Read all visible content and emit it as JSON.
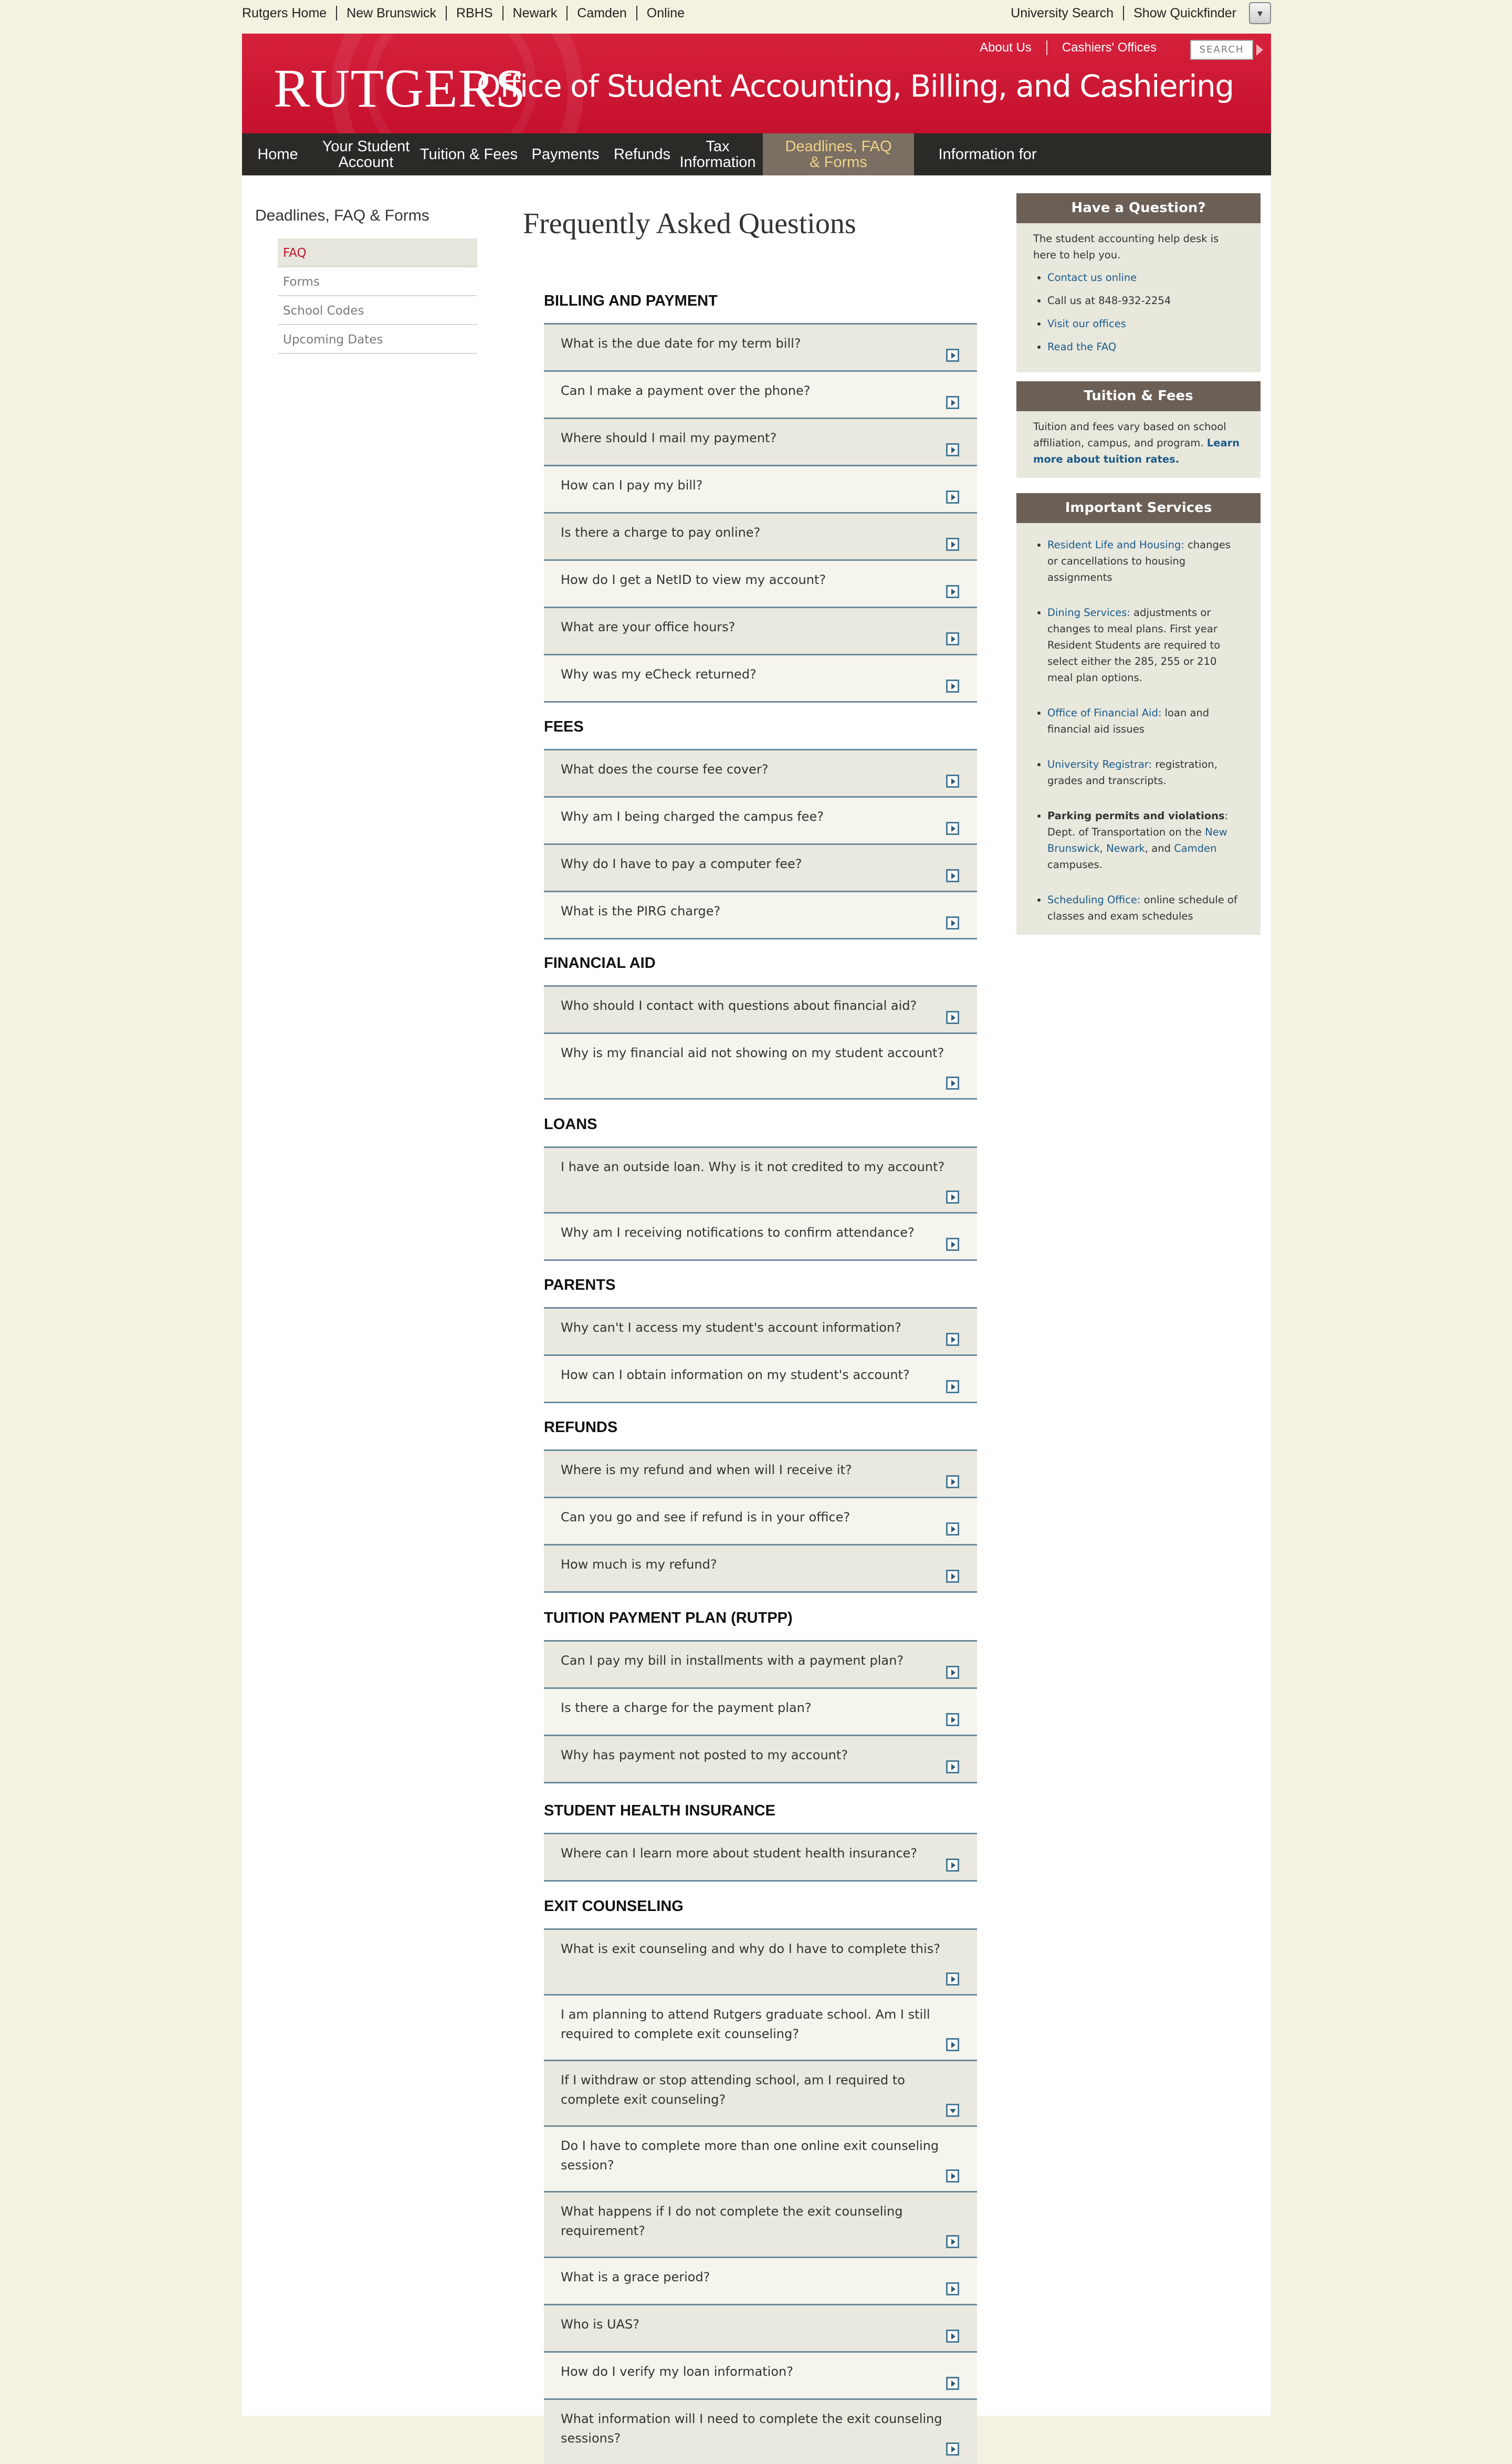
{
  "topbar": {
    "left_links": [
      "Rutgers Home",
      "New Brunswick",
      "RBHS",
      "Newark",
      "Camden",
      "Online"
    ],
    "right_links": [
      "University Search",
      "Show Quickfinder"
    ]
  },
  "header": {
    "logo": "RUTGERS",
    "site_title": "Office of Student Accounting, Billing, and Cashiering",
    "links": [
      "About Us",
      "Cashiers' Offices"
    ],
    "search_label": "SEARCH"
  },
  "nav": [
    {
      "label": "Home",
      "active": false
    },
    {
      "label": "Your Student\nAccount",
      "active": false
    },
    {
      "label": "Tuition & Fees",
      "active": false
    },
    {
      "label": "Payments",
      "active": false
    },
    {
      "label": "Refunds",
      "active": false
    },
    {
      "label": "Tax Information",
      "active": false
    },
    {
      "label": "Deadlines, FAQ\n& Forms",
      "active": true
    },
    {
      "label": "Information for",
      "active": false
    }
  ],
  "left": {
    "section_title": "Deadlines, FAQ & Forms",
    "items": [
      {
        "label": "FAQ",
        "active": true
      },
      {
        "label": "Forms",
        "active": false
      },
      {
        "label": "School Codes",
        "active": false
      },
      {
        "label": "Upcoming Dates",
        "active": false
      }
    ]
  },
  "faq": {
    "title": "Frequently Asked Questions",
    "categories": [
      {
        "name": "BILLING AND PAYMENT",
        "questions": [
          "What is the due date for my term bill?",
          "Can I make a payment over the phone?",
          "Where should I mail my payment?",
          "How can I pay my bill?",
          "Is there a charge to pay online?",
          "How do I get a NetID to view my account?",
          "What are your office hours?",
          "Why was my eCheck returned?"
        ]
      },
      {
        "name": "FEES",
        "questions": [
          "What does the course fee cover?",
          "Why am I being charged the campus fee?",
          "Why do I have to pay a computer fee?",
          "What is the PIRG charge?"
        ]
      },
      {
        "name": "FINANCIAL AID",
        "questions": [
          "Who should I contact with questions about financial aid?",
          "Why is my financial aid not showing on my student account?"
        ]
      },
      {
        "name": "LOANS",
        "questions": [
          "I have an outside loan. Why is it not credited to my account?",
          "Why am I receiving notifications to confirm attendance?"
        ]
      },
      {
        "name": "PARENTS",
        "questions": [
          "Why can't I access my student's account information?",
          "How can I obtain information on my student's account?"
        ]
      },
      {
        "name": "REFUNDS",
        "questions": [
          "Where is my refund and when will I receive it?",
          "Can you go and see if refund is in your office?",
          "How much is my refund?"
        ]
      },
      {
        "name": "TUITION PAYMENT PLAN (RUTPP)",
        "questions": [
          "Can I pay my bill in installments with a payment plan?",
          "Is there a charge for the payment plan?",
          "Why has payment not posted to my account?"
        ]
      },
      {
        "name": "STUDENT HEALTH INSURANCE",
        "questions": [
          "Where can I learn more about student health insurance?"
        ]
      },
      {
        "name": "EXIT COUNSELING",
        "questions": [
          "What is exit counseling and why do I have to complete this?",
          "I am planning to attend Rutgers graduate school. Am I still required to complete exit counseling?",
          "If I withdraw or stop attending school, am I required to complete exit counseling?",
          "Do I have to complete more than one online exit counseling session?",
          "What happens if I do not complete the exit counseling requirement?",
          "What is a grace period?",
          "Who is UAS?",
          "How do I verify my loan information?",
          "What information will I need to complete the exit counseling sessions?"
        ]
      }
    ]
  },
  "sidebar": {
    "question": {
      "title": "Have a Question?",
      "intro": "The student accounting help desk is here to help you.",
      "items": [
        "Contact us online",
        "Call us at 848-932-2254",
        "Visit our offices",
        "Read the FAQ"
      ]
    },
    "tuition": {
      "title": "Tuition & Fees",
      "text": "Tuition and fees vary based on school affiliation, campus, and program.",
      "link": "Learn more about tuition rates."
    },
    "services": {
      "title": "Important Services",
      "items": [
        {
          "link": "Resident Life and Housing:",
          "text": " changes or cancellations to housing assignments"
        },
        {
          "link": "Dining Services:",
          "text": " adjustments or changes to meal plans. First year Resident Students are required to select either the 285, 255 or 210 meal plan options."
        },
        {
          "link": "Office of Financial Aid:",
          "text": " loan and financial aid issues"
        },
        {
          "link": "University Registrar:",
          "text": " registration, grades and transcripts."
        },
        {
          "strong": "Parking permits and violations",
          "text_a": ": Dept. of Transportation on the ",
          "link_a": "New Brunswick",
          "text_b": ", ",
          "link_b": "Newark",
          "text_c": ", and ",
          "link_c": "Camden",
          "text_d": " campuses."
        },
        {
          "link": "Scheduling Office:",
          "text": " online schedule of classes and exam schedules"
        }
      ]
    }
  }
}
